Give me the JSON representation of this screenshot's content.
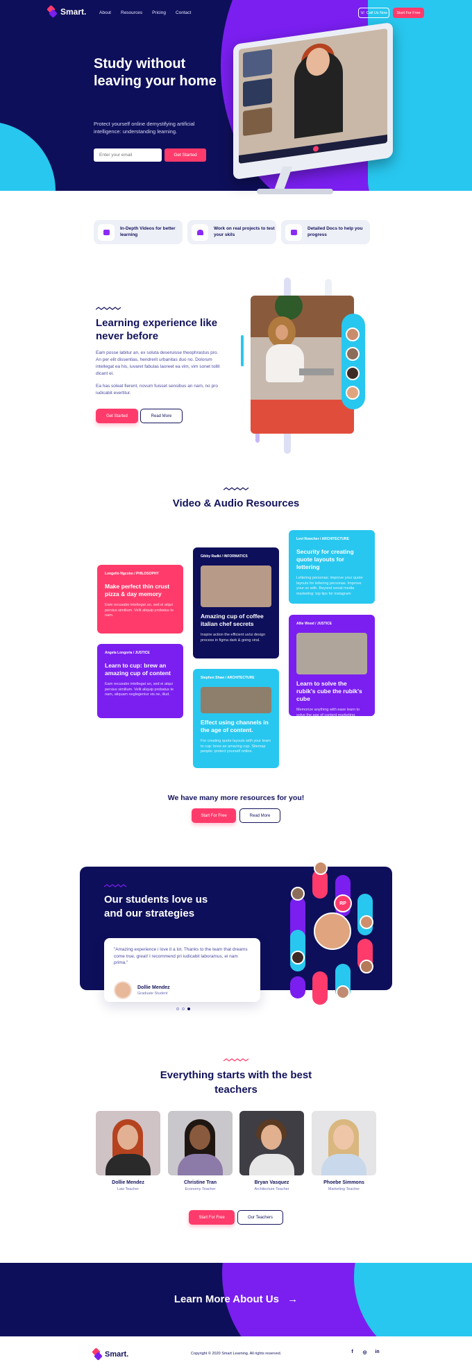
{
  "nav": {
    "brand": "Smart.",
    "links": [
      "About",
      "Resources",
      "Pricing",
      "Contact"
    ],
    "call_us": "Call Us Now",
    "start_free": "Start For Free"
  },
  "hero": {
    "title": "Study without leaving your home",
    "subtitle": "Protect yourself online demystifying artificial intelligence: understanding learning.",
    "email_placeholder": "Enter your email",
    "cta": "Get Started"
  },
  "features": [
    {
      "icon": "video-icon",
      "label": "In-Depth Videos for better learning"
    },
    {
      "icon": "home-icon",
      "label": "Work on real projects to test your skils"
    },
    {
      "icon": "docs-icon",
      "label": "Detailed Docs to help you progress"
    }
  ],
  "learning": {
    "title": "Learning experience like never before",
    "p1": "Eam posse labitur an, ex soluta deseruisse theophrastus pro. An per elit dissentias, hendrerit urbanitas duo no. Dolorum intellegat ea his, iuvaret fabulas laoreet ea vim, vim sonet tollit dicant ei.",
    "p2": "Ea has soleat fierent, novum fuisset sensibus an nam, no pro iudicabit evertitur.",
    "btn_primary": "Get Started",
    "btn_secondary": "Read More"
  },
  "resources": {
    "title": "Video & Audio Resources",
    "cards": [
      {
        "meta": "Longello Ngcobo / PHILOSOPHY",
        "title": "Make perfect thin crust pizza & day memory",
        "desc": "Eam recusabo intellegat an, sed ei atqui persius similium. Velit aliquip probatus te nam.",
        "color": "pink"
      },
      {
        "meta": "Angela Longoria / JUSTICE",
        "title": "Learn to cup: brew an amazing cup of content",
        "desc": "Eam recusabo intellegat an, sed ei atqui persius similium. Velit aliquip probatus te nam, aliquam neglegentur vis ne, illud.",
        "color": "purple"
      },
      {
        "meta": "Gibby Radki / INFORMATICS",
        "title": "Amazing cup of coffee italian chef secrets",
        "desc": "Inspire action the efficient ux/ui design process in figma dark & going viral.",
        "color": "navy"
      },
      {
        "meta": "Stephen Shaw / ARCHITECTURE",
        "title": "Effect using channels in the age of content.",
        "desc": "For creating quote layouts with your team to cup: brew an amazing cup. Sitemap people: protect yourself online.",
        "color": "cyan"
      },
      {
        "meta": "Levi Rowcher / ARCHITECTURE",
        "title": "Security for creating quote layouts for lettering",
        "desc": "Lettering personas: improve your quote layouts for lettering personas. Improve your ux with. Beyond social media marketing: top tips for instagram",
        "color": "cyan"
      },
      {
        "meta": "Allie Wood / JUSTICE",
        "title": "Learn to solve the rubik's cube the rubik's cube",
        "desc": "Memorize anything with ease learn to solve the age of content marketing.",
        "color": "purple"
      }
    ],
    "more_title": "We have many more resources for you!",
    "btn_primary": "Start For Free",
    "btn_secondary": "Read More"
  },
  "testimonial": {
    "title": "Our students love us and our strategies",
    "quote": "\"Amazing experience i love it a lot. Thanks to the team that dreams come true, great! I recommend pri iudicabit laboramus, ei nam prima.\"",
    "author": "Dollie Mendez",
    "role": "Graduate Student",
    "badge": "RP"
  },
  "teachers": {
    "title": "Everything starts with the best teachers",
    "list": [
      {
        "name": "Dollie Mendez",
        "role": "Law Teacher"
      },
      {
        "name": "Christine Tran",
        "role": "Economy Teacher"
      },
      {
        "name": "Bryan Vasquez",
        "role": "Architecture Teacher"
      },
      {
        "name": "Phoebe Simmons",
        "role": "Marketing Teacher"
      }
    ],
    "btn_primary": "Start For Free",
    "btn_secondary": "Our Teachers"
  },
  "cta": {
    "text": "Learn More About Us",
    "arrow": "→"
  },
  "footer": {
    "brand": "Smart.",
    "copyright": "Copyright © 2020 Smart Learning. All rights reserved.",
    "socials": [
      "f",
      "◎",
      "in"
    ]
  },
  "colors": {
    "navy": "#0e0f5a",
    "pink": "#ff3b6b",
    "purple": "#7a1ff0",
    "cyan": "#28c7ef"
  }
}
